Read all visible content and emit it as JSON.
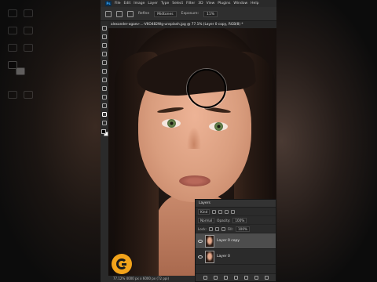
{
  "app": {
    "logo_text": "Ps"
  },
  "menubar": {
    "items": [
      "File",
      "Edit",
      "Image",
      "Layer",
      "Type",
      "Select",
      "Filter",
      "3D",
      "View",
      "Plugins",
      "Window",
      "Help"
    ]
  },
  "options": {
    "refine_label": "Refine",
    "mode_value": "Midtones",
    "exposure_label": "Exposure:",
    "exposure_value": "11%"
  },
  "document": {
    "tab_title": "alexander-agaev-...-V6O482Wg-unsplash.jpg @ 77.1% (Layer 0 copy, RGB/8) *"
  },
  "status": {
    "text": "77.12%   4000 px x 6000 px (72 ppi)"
  },
  "layers_panel": {
    "title": "Layers",
    "kind_label": "Kind",
    "blend_mode": "Normal",
    "opacity_label": "Opacity:",
    "opacity_value": "100%",
    "lock_label": "Lock:",
    "fill_label": "Fill:",
    "fill_value": "100%",
    "layers": [
      {
        "name": "Layer 0 copy",
        "active": true
      },
      {
        "name": "Layer 0",
        "active": false
      }
    ]
  },
  "colors": {
    "fg": "#000000",
    "bg": "#ffffff",
    "logo": "#f2a31b"
  }
}
